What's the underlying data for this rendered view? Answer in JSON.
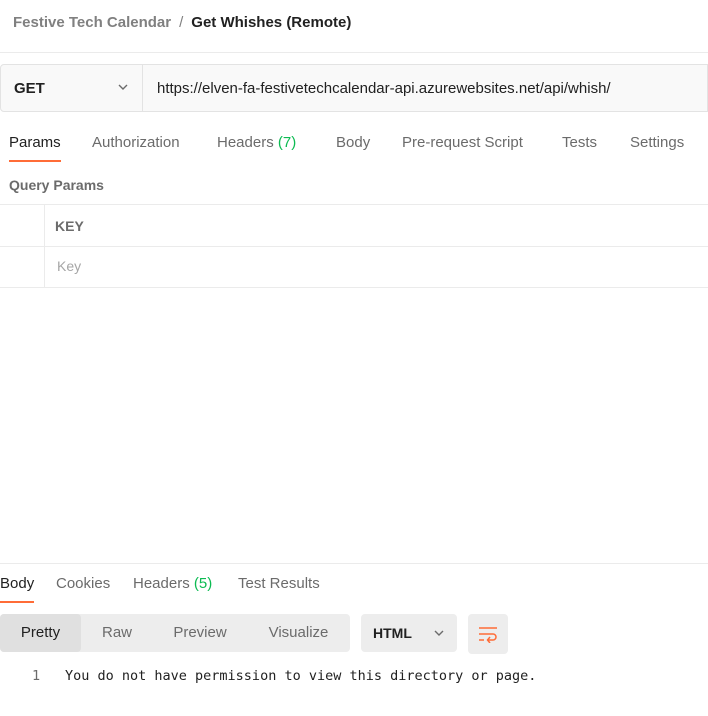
{
  "breadcrumb": {
    "parent": "Festive Tech Calendar",
    "separator": "/",
    "current": "Get Whishes (Remote)"
  },
  "request": {
    "method": "GET",
    "url": "https://elven-fa-festivetechcalendar-api.azurewebsites.net/api/whish/"
  },
  "request_tabs": [
    {
      "label": "Params",
      "count": "",
      "active": true
    },
    {
      "label": "Authorization",
      "count": "",
      "active": false
    },
    {
      "label": "Headers",
      "count": "(7)",
      "active": false
    },
    {
      "label": "Body",
      "count": "",
      "active": false
    },
    {
      "label": "Pre-request Script",
      "count": "",
      "active": false
    },
    {
      "label": "Tests",
      "count": "",
      "active": false
    },
    {
      "label": "Settings",
      "count": "",
      "active": false
    }
  ],
  "query_params": {
    "title": "Query Params",
    "column_key": "KEY",
    "key_placeholder": "Key"
  },
  "response_tabs": [
    {
      "label": "Body",
      "count": "",
      "active": true
    },
    {
      "label": "Cookies",
      "count": "",
      "active": false
    },
    {
      "label": "Headers",
      "count": "(5)",
      "active": false
    },
    {
      "label": "Test Results",
      "count": "",
      "active": false
    }
  ],
  "view_modes": [
    {
      "label": "Pretty",
      "active": true
    },
    {
      "label": "Raw",
      "active": false
    },
    {
      "label": "Preview",
      "active": false
    },
    {
      "label": "Visualize",
      "active": false
    }
  ],
  "format": {
    "selected": "HTML"
  },
  "icons": {
    "method_dropdown": "chevron-down-icon",
    "format_dropdown": "chevron-down-icon",
    "wrap": "wrap-lines-icon"
  },
  "colors": {
    "accent": "#ff6c37",
    "count": "#0cbb52"
  },
  "response_body": [
    {
      "line": "1",
      "text": "You do not have permission to view this directory or page."
    }
  ]
}
